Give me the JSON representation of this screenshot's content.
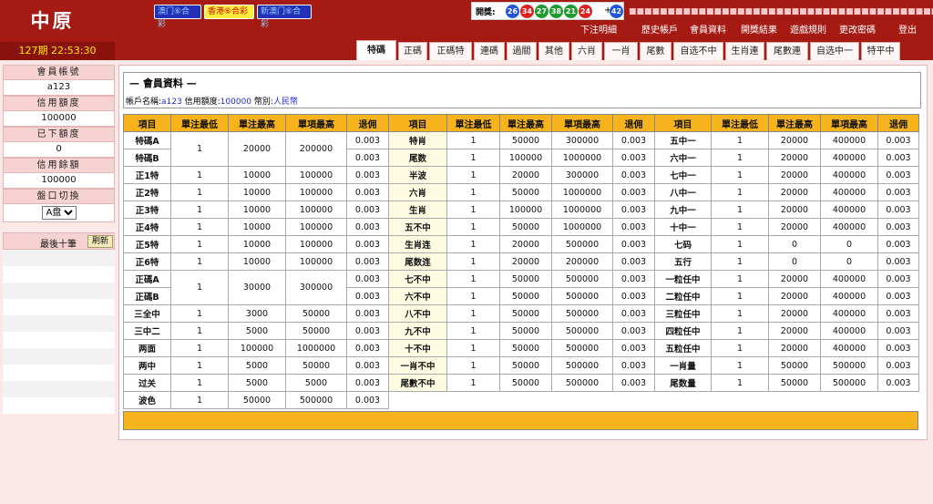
{
  "header": {
    "logo": "中原",
    "server_time": "127期 22:53:30",
    "lottery_buttons": [
      "澳门⑥合彩",
      "香港⑥合彩",
      "新澳门⑥合彩"
    ],
    "draw_label": "開獎:",
    "draw_numbers": [
      {
        "num": "26",
        "color": "#2255dd"
      },
      {
        "num": "34",
        "color": "#e02020"
      },
      {
        "num": "27",
        "color": "#1e9b2e"
      },
      {
        "num": "38",
        "color": "#1e9b2e"
      },
      {
        "num": "21",
        "color": "#1e9b2e"
      },
      {
        "num": "24",
        "color": "#e02020"
      },
      {
        "num": "42",
        "color": "#2255dd"
      }
    ],
    "draw_plus": "+",
    "marquee": "■■■■■■■■■■■■■■■■■■■■■■■■■■■■■■■■■■■■■■■■■■■■■■■■■",
    "top_links": [
      "下注明細",
      "歷史帳戶",
      "會員資料",
      "開獎結果",
      "遊戲規則",
      "更改密碼",
      "登出"
    ],
    "tabs": [
      "特碼",
      "正碼",
      "正碼特",
      "連碼",
      "過關",
      "其他",
      "六肖",
      "一肖",
      "尾數",
      "自选不中",
      "生肖連",
      "尾數連",
      "自选中一",
      "特平中"
    ]
  },
  "sidebar": {
    "items": [
      {
        "label": "會員帳號",
        "value": "a123"
      },
      {
        "label": "信用額度",
        "value": "100000"
      },
      {
        "label": "已下額度",
        "value": "0"
      },
      {
        "label": "信用餘額",
        "value": "100000"
      }
    ],
    "switch_label": "盤口切換",
    "switch_value": "A盘",
    "recent_label": "最後十筆",
    "refresh_label": "刷新"
  },
  "member_info": {
    "title": "— 會員資料 —",
    "account_label": "帳戶名稱:",
    "account": "a123",
    "credit_label": "信用額度:",
    "credit": "100000",
    "currency_label": "幣別:",
    "currency": "人民幣"
  },
  "table": {
    "headers": [
      "項目",
      "單注最低",
      "單注最高",
      "單項最高",
      "退佣"
    ],
    "col1": [
      {
        "name": "特碼A",
        "min": "1",
        "max": "20000",
        "item_max": "200000",
        "rebate": "0.003"
      },
      {
        "name": "特碼B",
        "rebate": "0.003"
      },
      {
        "name": "正1特",
        "min": "1",
        "max": "10000",
        "item_max": "100000",
        "rebate": "0.003"
      },
      {
        "name": "正2特",
        "min": "1",
        "max": "10000",
        "item_max": "100000",
        "rebate": "0.003"
      },
      {
        "name": "正3特",
        "min": "1",
        "max": "10000",
        "item_max": "100000",
        "rebate": "0.003"
      },
      {
        "name": "正4特",
        "min": "1",
        "max": "10000",
        "item_max": "100000",
        "rebate": "0.003"
      },
      {
        "name": "正5特",
        "min": "1",
        "max": "10000",
        "item_max": "100000",
        "rebate": "0.003"
      },
      {
        "name": "正6特",
        "min": "1",
        "max": "10000",
        "item_max": "100000",
        "rebate": "0.003"
      },
      {
        "name": "正碼A",
        "min": "1",
        "max": "30000",
        "item_max": "300000",
        "rebate": "0.003"
      },
      {
        "name": "正碼B",
        "rebate": "0.003"
      },
      {
        "name": "三全中",
        "min": "1",
        "max": "3000",
        "item_max": "50000",
        "rebate": "0.003"
      },
      {
        "name": "三中二",
        "min": "1",
        "max": "5000",
        "item_max": "50000",
        "rebate": "0.003"
      },
      {
        "name": "两面",
        "min": "1",
        "max": "100000",
        "item_max": "1000000",
        "rebate": "0.003"
      },
      {
        "name": "两中",
        "min": "1",
        "max": "5000",
        "item_max": "50000",
        "rebate": "0.003"
      },
      {
        "name": "过关",
        "min": "1",
        "max": "5000",
        "item_max": "5000",
        "rebate": "0.003"
      },
      {
        "name": "波色",
        "min": "1",
        "max": "50000",
        "item_max": "500000",
        "rebate": "0.003"
      }
    ],
    "col2": [
      {
        "name": "特肖",
        "min": "1",
        "max": "50000",
        "item_max": "300000",
        "rebate": "0.003"
      },
      {
        "name": "尾数",
        "min": "1",
        "max": "100000",
        "item_max": "1000000",
        "rebate": "0.003"
      },
      {
        "name": "半波",
        "min": "1",
        "max": "20000",
        "item_max": "300000",
        "rebate": "0.003"
      },
      {
        "name": "六肖",
        "min": "1",
        "max": "50000",
        "item_max": "1000000",
        "rebate": "0.003"
      },
      {
        "name": "生肖",
        "min": "1",
        "max": "100000",
        "item_max": "1000000",
        "rebate": "0.003"
      },
      {
        "name": "五不中",
        "min": "1",
        "max": "50000",
        "item_max": "1000000",
        "rebate": "0.003"
      },
      {
        "name": "生肖连",
        "min": "1",
        "max": "20000",
        "item_max": "500000",
        "rebate": "0.003"
      },
      {
        "name": "尾数连",
        "min": "1",
        "max": "20000",
        "item_max": "200000",
        "rebate": "0.003"
      },
      {
        "name": "七不中",
        "min": "1",
        "max": "50000",
        "item_max": "500000",
        "rebate": "0.003"
      },
      {
        "name": "六不中",
        "min": "1",
        "max": "50000",
        "item_max": "500000",
        "rebate": "0.003"
      },
      {
        "name": "八不中",
        "min": "1",
        "max": "50000",
        "item_max": "500000",
        "rebate": "0.003"
      },
      {
        "name": "九不中",
        "min": "1",
        "max": "50000",
        "item_max": "500000",
        "rebate": "0.003"
      },
      {
        "name": "十不中",
        "min": "1",
        "max": "50000",
        "item_max": "500000",
        "rebate": "0.003"
      },
      {
        "name": "一肖不中",
        "min": "1",
        "max": "50000",
        "item_max": "500000",
        "rebate": "0.003"
      },
      {
        "name": "尾數不中",
        "min": "1",
        "max": "50000",
        "item_max": "500000",
        "rebate": "0.003"
      }
    ],
    "col3": [
      {
        "name": "五中一",
        "min": "1",
        "max": "20000",
        "item_max": "400000",
        "rebate": "0.003"
      },
      {
        "name": "六中一",
        "min": "1",
        "max": "20000",
        "item_max": "400000",
        "rebate": "0.003"
      },
      {
        "name": "七中一",
        "min": "1",
        "max": "20000",
        "item_max": "400000",
        "rebate": "0.003"
      },
      {
        "name": "八中一",
        "min": "1",
        "max": "20000",
        "item_max": "400000",
        "rebate": "0.003"
      },
      {
        "name": "九中一",
        "min": "1",
        "max": "20000",
        "item_max": "400000",
        "rebate": "0.003"
      },
      {
        "name": "十中一",
        "min": "1",
        "max": "20000",
        "item_max": "400000",
        "rebate": "0.003"
      },
      {
        "name": "七码",
        "min": "1",
        "max": "0",
        "item_max": "0",
        "rebate": "0.003"
      },
      {
        "name": "五行",
        "min": "1",
        "max": "0",
        "item_max": "0",
        "rebate": "0.003"
      },
      {
        "name": "一粒任中",
        "min": "1",
        "max": "20000",
        "item_max": "400000",
        "rebate": "0.003"
      },
      {
        "name": "二粒任中",
        "min": "1",
        "max": "20000",
        "item_max": "400000",
        "rebate": "0.003"
      },
      {
        "name": "三粒任中",
        "min": "1",
        "max": "20000",
        "item_max": "400000",
        "rebate": "0.003"
      },
      {
        "name": "四粒任中",
        "min": "1",
        "max": "20000",
        "item_max": "400000",
        "rebate": "0.003"
      },
      {
        "name": "五粒任中",
        "min": "1",
        "max": "20000",
        "item_max": "400000",
        "rebate": "0.003"
      },
      {
        "name": "一肖量",
        "min": "1",
        "max": "50000",
        "item_max": "500000",
        "rebate": "0.003"
      },
      {
        "name": "尾数量",
        "min": "1",
        "max": "50000",
        "item_max": "500000",
        "rebate": "0.003"
      }
    ]
  }
}
